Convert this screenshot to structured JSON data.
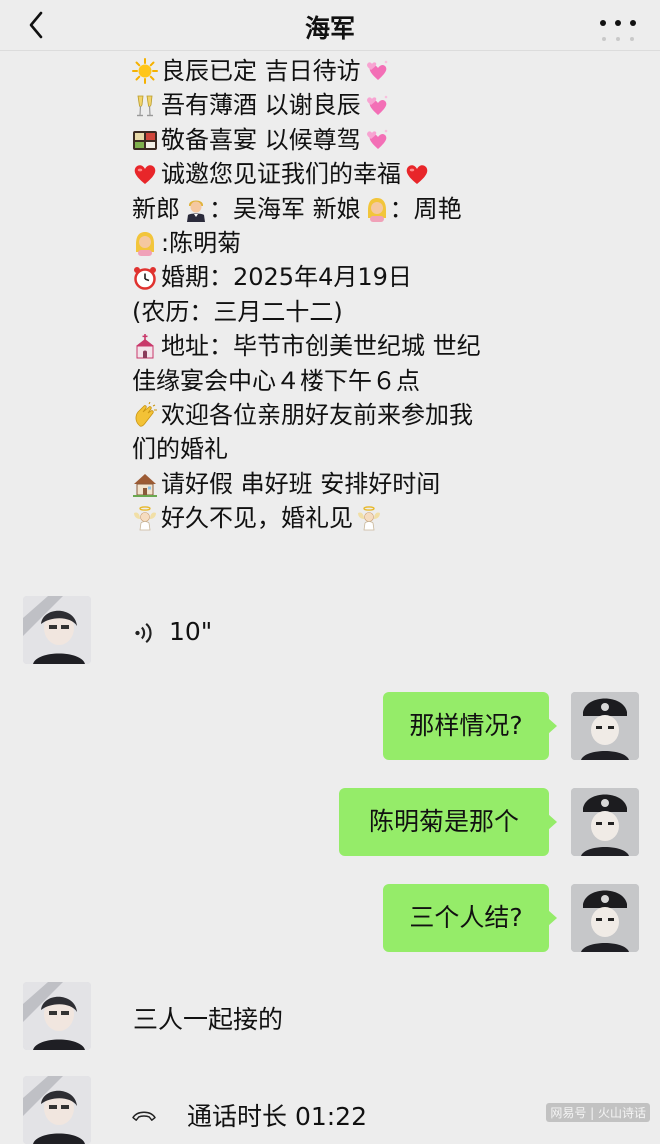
{
  "header": {
    "title": "海军"
  },
  "message": {
    "lines": [
      "良辰已定 吉日待访",
      "吾有薄酒 以谢良辰",
      "敬备喜宴 以候尊驾",
      "诚邀您见证我们的幸福",
      "新郎",
      "：吴海军 新娘",
      "：周艳",
      ":陈明菊",
      "婚期：2025年4月19日",
      "(农历：三月二十二)",
      "地址：毕节市创美世纪城 世纪",
      "佳缘宴会中心４楼下午６点",
      "欢迎各位亲朋好友前来参加我",
      "们的婚礼",
      "请好假 串好班 安排好时间",
      "好久不见，婚礼见"
    ]
  },
  "voice": {
    "duration": "10\""
  },
  "outgoing": [
    {
      "text": "那样情况?"
    },
    {
      "text": "陈明菊是那个"
    },
    {
      "text": "三个人结?"
    }
  ],
  "incoming_text": "三人一起接的",
  "call": {
    "text": "通话时长 01:22"
  },
  "watermark": "网易号 | 火山诗话",
  "colors": {
    "background": "#ededed",
    "bubble": "#95ec69"
  },
  "icons": [
    "back-arrow-icon",
    "more-dots-icon",
    "sun-icon",
    "champagne-icon",
    "bento-icon",
    "heart-icon",
    "groom-icon",
    "bride-icon",
    "alarm-clock-icon",
    "church-icon",
    "clap-icon",
    "house-icon",
    "angel-icon",
    "sparkle-hearts-icon",
    "voice-wave-icon",
    "phone-icon"
  ]
}
